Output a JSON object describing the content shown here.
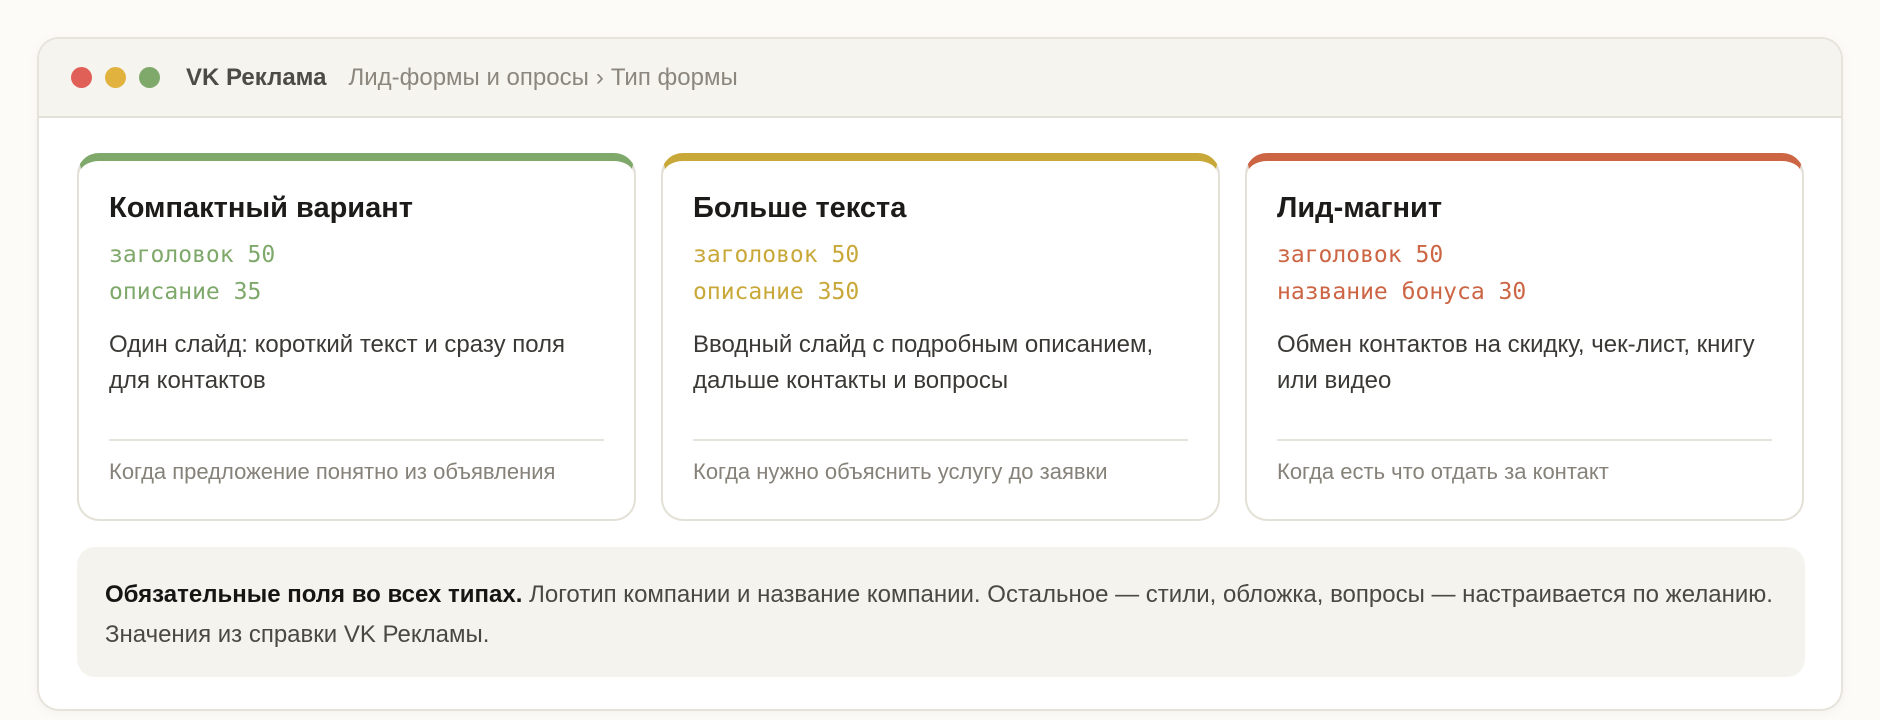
{
  "window": {
    "app_title": "VK Реклама",
    "breadcrumb": [
      "Лид-формы и опросы",
      "Тип формы"
    ],
    "breadcrumb_separator": "›",
    "traffic_lights": [
      "#e05f57",
      "#e2b23f",
      "#7fa86b"
    ]
  },
  "cards": [
    {
      "title": "Компактный вариант",
      "accent": "#7fa86b",
      "limits": [
        "заголовок 50",
        "описание 35"
      ],
      "description": "Один слайд: короткий текст и сразу поля для контактов",
      "use_case": "Когда предложение понятно из объявления"
    },
    {
      "title": "Больше текста",
      "accent": "#c9a83a",
      "limits": [
        "заголовок 50",
        "описание 350"
      ],
      "description": "Вводный слайд с подробным описанием, дальше контакты и вопросы",
      "use_case": "Когда нужно объяснить услугу до заявки"
    },
    {
      "title": "Лид-магнит",
      "accent": "#cc6544",
      "limits": [
        "заголовок 50",
        "название бонуса 30"
      ],
      "description": "Обмен контактов на скидку, чек-лист, книгу или видео",
      "use_case": "Когда есть что отдать за контакт"
    }
  ],
  "note": {
    "strong": "Обязательные поля во всех типах.",
    "text": " Логотип компании и название компании. Остальное — стили, обложка, вопросы — настраивается по желанию. Значения из справки VK Рекламы."
  }
}
